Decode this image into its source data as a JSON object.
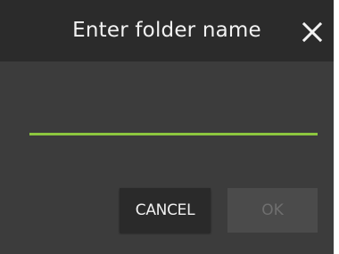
{
  "dialog": {
    "title": "Enter folder name",
    "close_icon": "close-icon",
    "input": {
      "value": "",
      "placeholder": "",
      "underline_color": "#8cc63f"
    },
    "buttons": {
      "cancel_label": "CANCEL",
      "ok_label": "OK",
      "ok_disabled": true
    },
    "colors": {
      "title_bar": "#2b2b2b",
      "body": "#3c3c3c",
      "accent": "#8cc63f"
    }
  }
}
